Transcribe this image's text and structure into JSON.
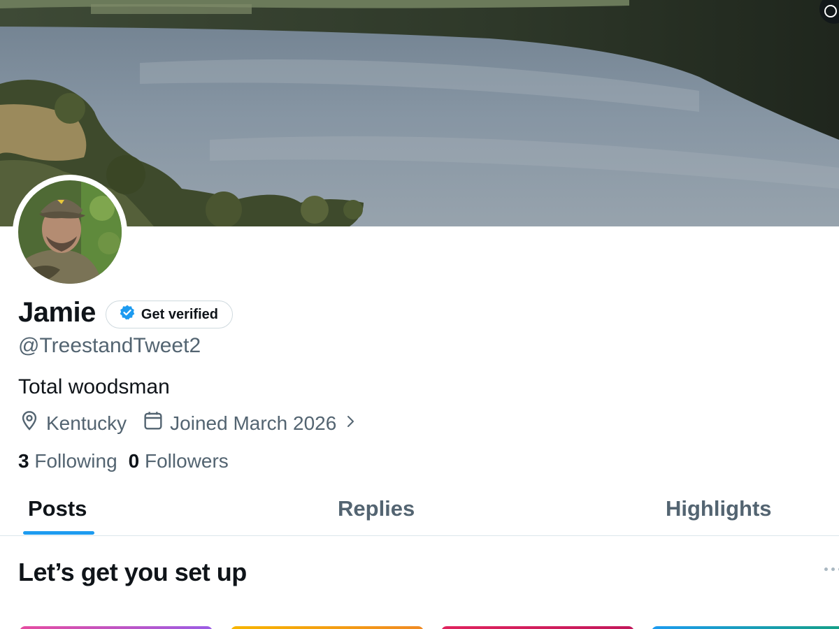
{
  "profile": {
    "display_name": "Jamie",
    "verify_label": "Get verified",
    "handle": "@TreestandTweet2",
    "bio": "Total woodsman",
    "location": "Kentucky",
    "joined": "Joined March 2026",
    "following_count": "3",
    "following_label": "Following",
    "followers_count": "0",
    "followers_label": "Followers"
  },
  "tabs": [
    {
      "label": "Posts",
      "active": true
    },
    {
      "label": "Replies",
      "active": false
    },
    {
      "label": "Highlights",
      "active": false
    }
  ],
  "setup": {
    "title": "Let’s get you set up"
  },
  "icons": {
    "verified_badge": "verified-badge-icon",
    "location": "location-pin-icon",
    "calendar": "calendar-icon",
    "chevron": "chevron-right-icon",
    "more": "more-icon"
  },
  "colors": {
    "accent": "#1d9bf0",
    "text_primary": "#0f1419",
    "text_secondary": "#536471"
  }
}
